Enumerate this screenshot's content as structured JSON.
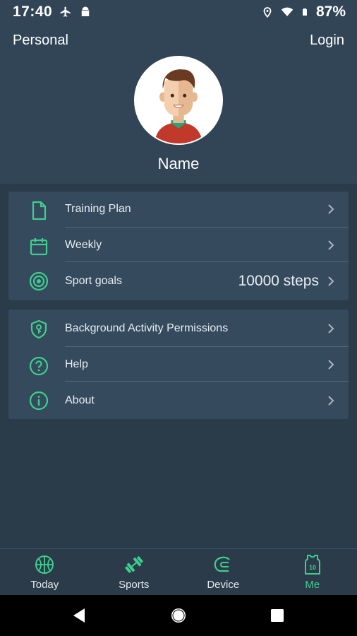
{
  "status_bar": {
    "time": "17:40",
    "battery": "87%"
  },
  "header": {
    "left_label": "Personal",
    "right_label": "Login",
    "user_name": "Name"
  },
  "colors": {
    "accent": "#3ecf8e",
    "header_bg": "#314557",
    "page_bg": "#2a3b4a",
    "card_bg": "#354a5c"
  },
  "menu_group_1": [
    {
      "icon": "document-icon",
      "label": "Training Plan",
      "value": ""
    },
    {
      "icon": "calendar-icon",
      "label": "Weekly",
      "value": ""
    },
    {
      "icon": "target-icon",
      "label": "Sport goals",
      "value": "10000 steps"
    }
  ],
  "menu_group_2": [
    {
      "icon": "shield-key-icon",
      "label": "Background Activity Permissions"
    },
    {
      "icon": "help-icon",
      "label": "Help"
    },
    {
      "icon": "info-icon",
      "label": "About"
    }
  ],
  "bottom_nav": [
    {
      "icon": "basketball-icon",
      "label": "Today",
      "active": false
    },
    {
      "icon": "dumbbell-icon",
      "label": "Sports",
      "active": false
    },
    {
      "icon": "band-icon",
      "label": "Device",
      "active": false
    },
    {
      "icon": "jersey-icon",
      "label": "Me",
      "active": true,
      "badge": "10"
    }
  ]
}
